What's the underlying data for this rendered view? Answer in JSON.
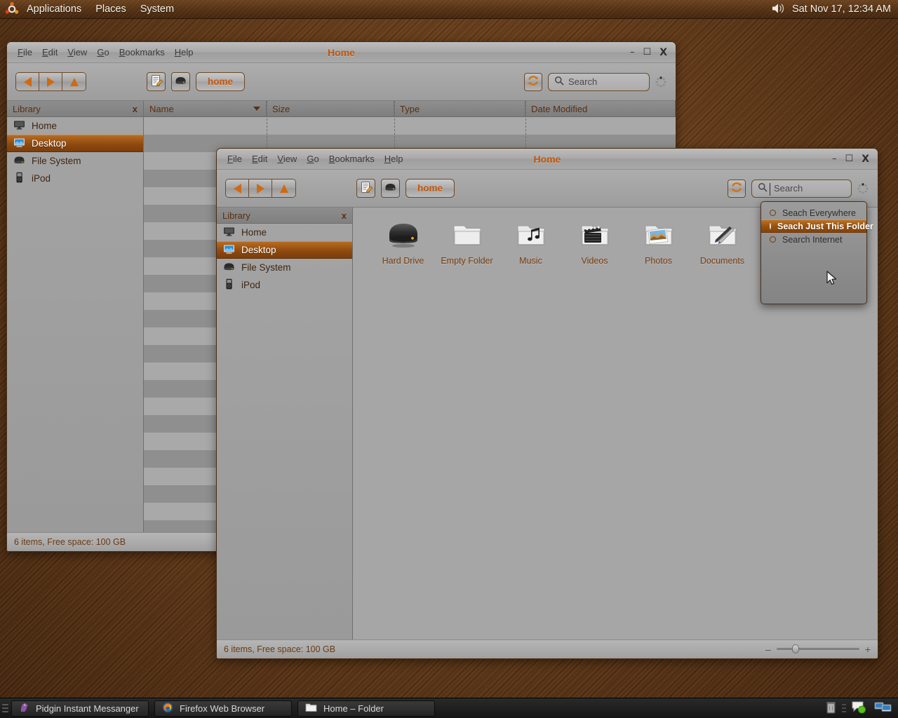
{
  "panel": {
    "logo_icon": "ubuntu-logo-icon",
    "menus": [
      "Applications",
      "Places",
      "System"
    ],
    "volume_icon": "volume-icon",
    "clock": "Sat Nov 17, 12:34 AM"
  },
  "back_window": {
    "title": "Home",
    "menus": [
      {
        "label": "File",
        "mnemonic": "F"
      },
      {
        "label": "Edit",
        "mnemonic": "E"
      },
      {
        "label": "View",
        "mnemonic": "V"
      },
      {
        "label": "Go",
        "mnemonic": "G"
      },
      {
        "label": "Bookmarks",
        "mnemonic": "B"
      },
      {
        "label": "Help",
        "mnemonic": "H"
      }
    ],
    "window_buttons": {
      "minimize": "–",
      "maximize": "☐",
      "close": "X"
    },
    "toolbar": {
      "back_icon": "arrow-left-icon",
      "forward_icon": "arrow-right-icon",
      "up_icon": "arrow-up-icon",
      "edit_icon": "edit-note-icon",
      "drive_icon": "hard-drive-icon",
      "breadcrumb": "home",
      "reload_icon": "reload-icon",
      "search_icon": "search-icon",
      "search_placeholder": "Search",
      "search_value": "",
      "throbber_icon": "throbber-icon"
    },
    "sidebar": {
      "title": "Library",
      "close_label": "x",
      "items": [
        {
          "label": "Home",
          "icon": "monitor-icon",
          "selected": false
        },
        {
          "label": "Desktop",
          "icon": "desktop-screen-icon",
          "selected": true
        },
        {
          "label": "File System",
          "icon": "hard-drive-icon",
          "selected": false
        },
        {
          "label": "iPod",
          "icon": "ipod-icon",
          "selected": false
        }
      ]
    },
    "columns": [
      {
        "label": "Name",
        "sorted": true
      },
      {
        "label": "Size",
        "sorted": false
      },
      {
        "label": "Type",
        "sorted": false
      },
      {
        "label": "Date Modified",
        "sorted": false
      }
    ],
    "row_count": 24,
    "statusbar": "6 items, Free space: 100 GB"
  },
  "front_window": {
    "title": "Home",
    "menus": [
      {
        "label": "File",
        "mnemonic": "F"
      },
      {
        "label": "Edit",
        "mnemonic": "E"
      },
      {
        "label": "View",
        "mnemonic": "V"
      },
      {
        "label": "Go",
        "mnemonic": "G"
      },
      {
        "label": "Bookmarks",
        "mnemonic": "B"
      },
      {
        "label": "Help",
        "mnemonic": "H"
      }
    ],
    "window_buttons": {
      "minimize": "–",
      "maximize": "☐",
      "close": "X"
    },
    "toolbar": {
      "back_icon": "arrow-left-icon",
      "forward_icon": "arrow-right-icon",
      "up_icon": "arrow-up-icon",
      "edit_icon": "edit-note-icon",
      "drive_icon": "hard-drive-icon",
      "breadcrumb": "home",
      "reload_icon": "reload-icon",
      "search_icon": "search-icon",
      "search_placeholder": "Search",
      "search_value": "",
      "throbber_icon": "throbber-icon"
    },
    "sidebar": {
      "title": "Library",
      "close_label": "x",
      "items": [
        {
          "label": "Home",
          "icon": "monitor-icon",
          "selected": false
        },
        {
          "label": "Desktop",
          "icon": "desktop-screen-icon",
          "selected": true
        },
        {
          "label": "File System",
          "icon": "hard-drive-icon",
          "selected": false
        },
        {
          "label": "iPod",
          "icon": "ipod-icon",
          "selected": false
        }
      ]
    },
    "icons": [
      {
        "label": "Hard Drive",
        "icon": "hard-drive-icon"
      },
      {
        "label": "Empty Folder",
        "icon": "folder-icon"
      },
      {
        "label": "Music",
        "icon": "folder-music-icon"
      },
      {
        "label": "Videos",
        "icon": "folder-videos-icon"
      },
      {
        "label": "Photos",
        "icon": "folder-photos-icon"
      },
      {
        "label": "Documents",
        "icon": "folder-documents-icon"
      }
    ],
    "statusbar": "6 items, Free space: 100 GB",
    "zoom": {
      "out_label": "–",
      "in_label": "+",
      "value": 20
    }
  },
  "search_menu": {
    "options": [
      {
        "label": "Seach Everywhere",
        "selected": false
      },
      {
        "label": "Seach Just This Folder",
        "selected": true
      },
      {
        "label": "Search Internet",
        "selected": false
      }
    ]
  },
  "taskbar": {
    "tasks": [
      {
        "label": "Pidgin Instant Messanger",
        "icon": "pidgin-icon"
      },
      {
        "label": "Firefox Web Browser",
        "icon": "firefox-icon"
      },
      {
        "label": "Home – Folder",
        "icon": "folder-icon"
      }
    ],
    "tray": {
      "trash_icon": "trash-icon",
      "chat_icon": "chat-bubble-icon",
      "workspace_icon": "workspace-switcher-icon"
    }
  },
  "colors": {
    "accent_orange": "#c0560c",
    "selection_orange": "#96500f",
    "desktop_brown": "#60391c",
    "window_grey": "#a9a9a9"
  }
}
